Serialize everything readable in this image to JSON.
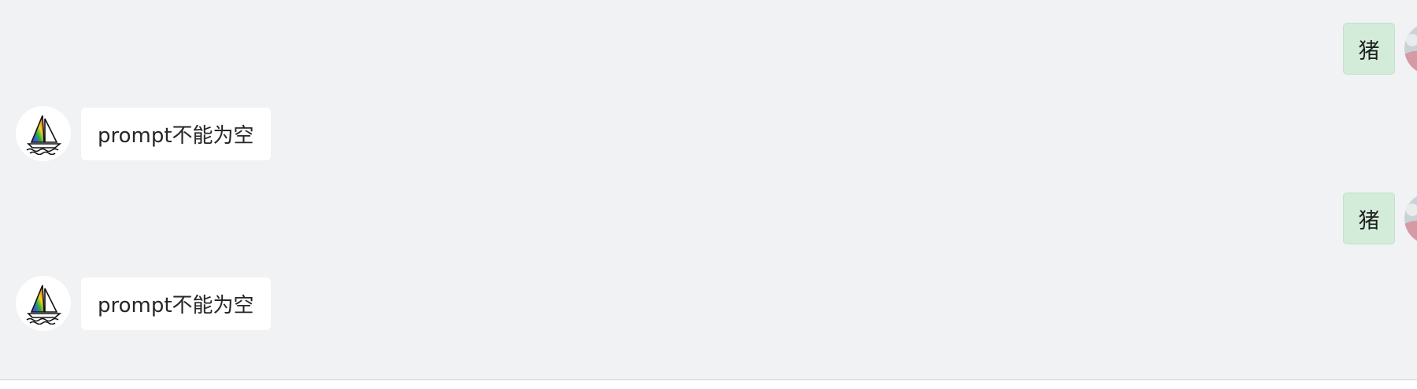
{
  "messages": [
    {
      "role": "user",
      "text": "猪",
      "avatar": "user-photo-icon"
    },
    {
      "role": "bot",
      "text": "prompt不能为空",
      "avatar": "sailboat-logo-icon"
    },
    {
      "role": "user",
      "text": "猪",
      "avatar": "user-photo-icon"
    },
    {
      "role": "bot",
      "text": "prompt不能为空",
      "avatar": "sailboat-logo-icon"
    }
  ],
  "colors": {
    "background": "#f1f2f4",
    "user_bubble": "#d3ecda",
    "bot_bubble": "#ffffff"
  }
}
